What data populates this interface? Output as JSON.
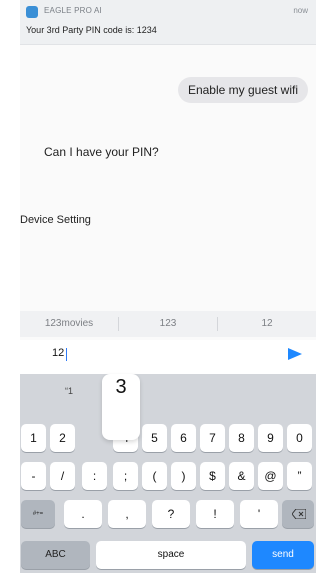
{
  "notification": {
    "app_name": "EAGLE PRO AI",
    "time": "now",
    "message": "Your 3rd Party PIN code is: 1234"
  },
  "chat": {
    "outgoing_message": "Enable my guest wifi",
    "incoming_message": "Can I have your PIN?",
    "device_setting": "Device Setting"
  },
  "suggestions": [
    "123movies",
    "123",
    "12"
  ],
  "input": {
    "value": "12"
  },
  "keyboard": {
    "popup_char": "3",
    "hint": "“1",
    "row1": [
      "1",
      "2",
      "",
      "4",
      "5",
      "6",
      "7",
      "8",
      "9",
      "0"
    ],
    "row2": [
      "-",
      "/",
      ":",
      ";",
      "(",
      ")",
      "$",
      "&",
      "@",
      "”"
    ],
    "row3_left": "#+=",
    "row3": [
      ".",
      ",",
      "?",
      "!",
      "'"
    ],
    "abc": "ABC",
    "space": "space",
    "send": "send"
  },
  "colors": {
    "accent": "#1e88ff",
    "keyboard_bg": "#d2d5da"
  }
}
